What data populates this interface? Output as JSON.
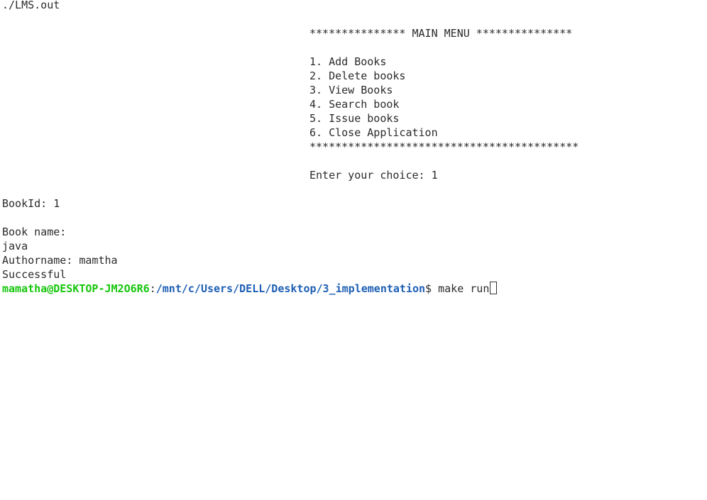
{
  "terminal": {
    "command_line": "./LMS.out",
    "menu": {
      "header": "*************** MAIN MENU ***************",
      "items": [
        "1. Add Books",
        "2. Delete books",
        "3. View Books",
        "4. Search book",
        "5. Issue books",
        "6. Close Application"
      ],
      "footer": "******************************************",
      "choice_prompt": "Enter your choice: 1"
    },
    "output": {
      "book_id": "BookId: 1",
      "book_name_label": "Book name:",
      "book_name_value": "java",
      "author": "Authorname: mamtha",
      "status": "Successful"
    },
    "prompt": {
      "user_host": "mamatha@DESKTOP-JM2O6R6",
      "separator": ":",
      "path": "/mnt/c/Users/DELL/Desktop/3_implementation",
      "dollar": "$ ",
      "input": "make run"
    },
    "colors": {
      "background": "#ffffff",
      "text": "#2b2b2b",
      "user_host": "#16c60c",
      "path": "#1e5fb4"
    }
  }
}
